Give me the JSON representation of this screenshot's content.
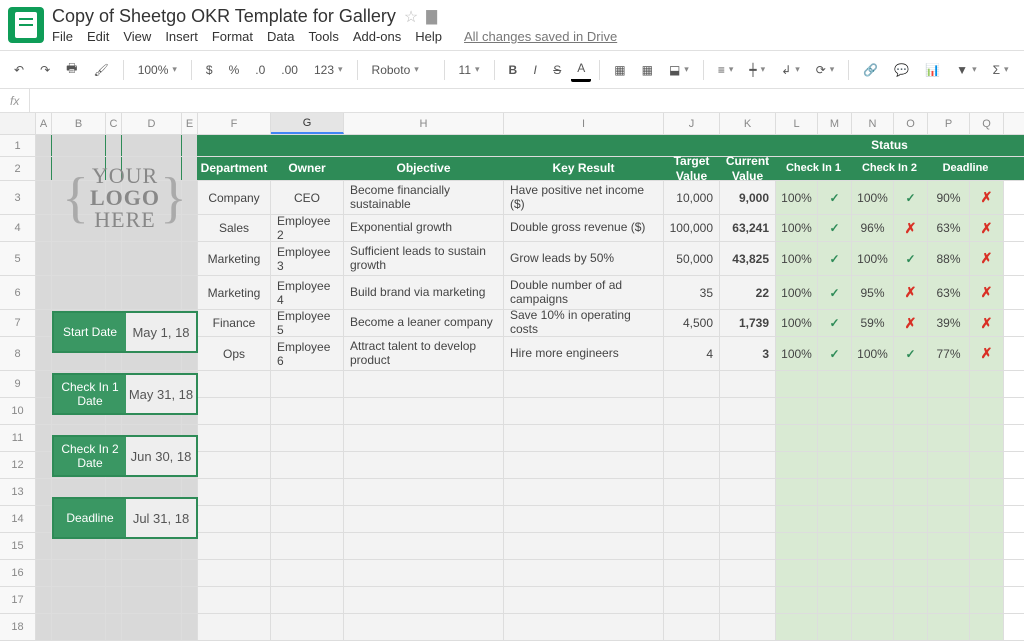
{
  "doc_title": "Copy of Sheetgo OKR Template for Gallery",
  "saved_msg": "All changes saved in Drive",
  "menu": {
    "file": "File",
    "edit": "Edit",
    "view": "View",
    "insert": "Insert",
    "format": "Format",
    "data": "Data",
    "tools": "Tools",
    "addons": "Add-ons",
    "help": "Help"
  },
  "toolbar": {
    "zoom": "100%",
    "font": "Roboto",
    "size": "11",
    "numfmt": "123"
  },
  "formula_fx": "fx",
  "cols": [
    "A",
    "B",
    "C",
    "D",
    "E",
    "F",
    "G",
    "H",
    "I",
    "J",
    "K",
    "L",
    "M",
    "N",
    "O",
    "P",
    "Q"
  ],
  "logo": {
    "l1": "YOUR",
    "l2": "LOGO",
    "l3": "HERE"
  },
  "cards": {
    "start": {
      "label": "Start Date",
      "value": "May 1, 18"
    },
    "c1": {
      "label": "Check In 1 Date",
      "value": "May 31, 18"
    },
    "c2": {
      "label": "Check In 2 Date",
      "value": "Jun 30, 18"
    },
    "dl": {
      "label": "Deadline",
      "value": "Jul 31, 18"
    }
  },
  "headers": {
    "dept": "Department",
    "owner": "Owner",
    "obj": "Objective",
    "kr": "Key Result",
    "target": "Target Value",
    "current": "Current Value",
    "status": "Status",
    "ci1": "Check In 1",
    "ci2": "Check In 2",
    "dl": "Deadline"
  },
  "rows": [
    {
      "dept": "Company",
      "owner": "CEO",
      "obj": "Become financially sustainable",
      "kr": "Have positive net income ($)",
      "target": "10,000",
      "current": "9,000",
      "ci1": "100%",
      "ci1s": "✓",
      "ci2": "100%",
      "ci2s": "✓",
      "dl": "90%",
      "dls": "✗"
    },
    {
      "dept": "Sales",
      "owner": "Employee 2",
      "obj": "Exponential growth",
      "kr": "Double gross revenue ($)",
      "target": "100,000",
      "current": "63,241",
      "ci1": "100%",
      "ci1s": "✓",
      "ci2": "96%",
      "ci2s": "✗",
      "dl": "63%",
      "dls": "✗"
    },
    {
      "dept": "Marketing",
      "owner": "Employee 3",
      "obj": "Sufficient leads to sustain growth",
      "kr": "Grow leads by 50%",
      "target": "50,000",
      "current": "43,825",
      "ci1": "100%",
      "ci1s": "✓",
      "ci2": "100%",
      "ci2s": "✓",
      "dl": "88%",
      "dls": "✗"
    },
    {
      "dept": "Marketing",
      "owner": "Employee 4",
      "obj": "Build brand via marketing",
      "kr": "Double number of ad campaigns",
      "target": "35",
      "current": "22",
      "ci1": "100%",
      "ci1s": "✓",
      "ci2": "95%",
      "ci2s": "✗",
      "dl": "63%",
      "dls": "✗"
    },
    {
      "dept": "Finance",
      "owner": "Employee 5",
      "obj": "Become a leaner company",
      "kr": "Save 10% in operating costs",
      "target": "4,500",
      "current": "1,739",
      "ci1": "100%",
      "ci1s": "✓",
      "ci2": "59%",
      "ci2s": "✗",
      "dl": "39%",
      "dls": "✗"
    },
    {
      "dept": "Ops",
      "owner": "Employee 6",
      "obj": "Attract talent to develop product",
      "kr": "Hire more engineers",
      "target": "4",
      "current": "3",
      "ci1": "100%",
      "ci1s": "✓",
      "ci2": "100%",
      "ci2s": "✓",
      "dl": "77%",
      "dls": "✗"
    }
  ]
}
